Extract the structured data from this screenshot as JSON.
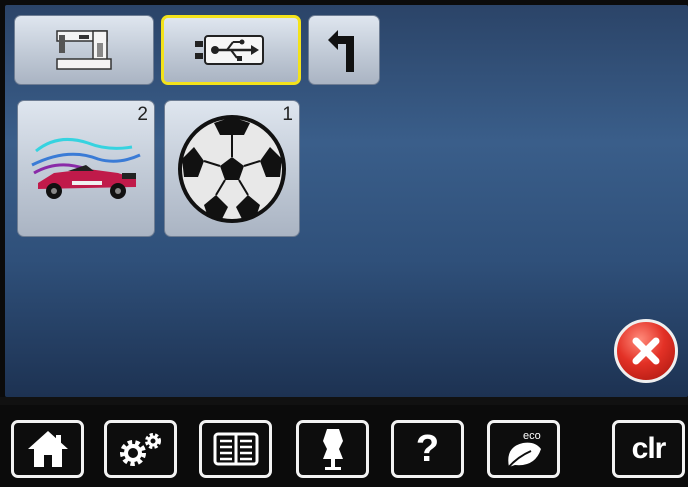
{
  "top_buttons": [
    {
      "name": "sewing-machine-source-button",
      "icon": "sewing-machine-icon",
      "selected": false
    },
    {
      "name": "usb-source-button",
      "icon": "usb-icon",
      "selected": true
    },
    {
      "name": "back-button",
      "icon": "return-arrow-icon",
      "selected": false
    }
  ],
  "designs": [
    {
      "name": "design-race-car",
      "icon": "race-car-design-icon",
      "badge": "2"
    },
    {
      "name": "design-soccer-ball",
      "icon": "soccer-ball-design-icon",
      "badge": "1"
    }
  ],
  "toolbar": {
    "items": [
      {
        "name": "home-button",
        "icon": "home-icon"
      },
      {
        "name": "setup-button",
        "icon": "gears-icon"
      },
      {
        "name": "tutorial-button",
        "icon": "book-icon"
      },
      {
        "name": "creative-consultant-button",
        "icon": "dress-form-icon"
      },
      {
        "name": "help-button",
        "icon": "question-icon",
        "label": "?"
      },
      {
        "name": "eco-button",
        "icon": "eco-leaf-icon",
        "label": "eco"
      },
      {
        "name": "clear-button",
        "icon": "clear-icon",
        "label": "clr"
      }
    ]
  },
  "colors": {
    "selection_highlight": "#f3e21b",
    "close_button": "#e33126",
    "background_top": "#2b4468",
    "background_bottom": "#1d3252"
  }
}
